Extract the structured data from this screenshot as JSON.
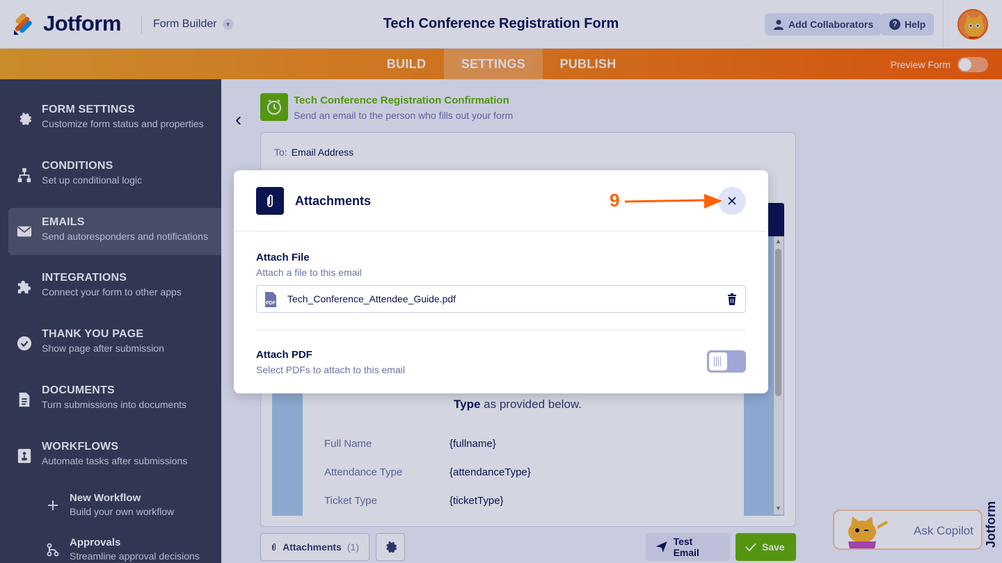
{
  "header": {
    "brand": "Jotform",
    "builder_menu": "Form Builder",
    "form_title": "Tech Conference Registration Form",
    "add_collaborators": "Add Collaborators",
    "help": "Help"
  },
  "nav": {
    "tabs": [
      {
        "label": "BUILD"
      },
      {
        "label": "SETTINGS"
      },
      {
        "label": "PUBLISH"
      }
    ],
    "active_tab": "SETTINGS",
    "preview_form": "Preview Form"
  },
  "sidebar": {
    "items": [
      {
        "title": "FORM SETTINGS",
        "subtitle": "Customize form status and properties",
        "icon": "gear-icon"
      },
      {
        "title": "CONDITIONS",
        "subtitle": "Set up conditional logic",
        "icon": "conditions-icon"
      },
      {
        "title": "EMAILS",
        "subtitle": "Send autoresponders and notifications",
        "icon": "envelope-icon"
      },
      {
        "title": "INTEGRATIONS",
        "subtitle": "Connect your form to other apps",
        "icon": "puzzle-icon"
      },
      {
        "title": "THANK YOU PAGE",
        "subtitle": "Show page after submission",
        "icon": "check-circle-icon"
      },
      {
        "title": "DOCUMENTS",
        "subtitle": "Turn submissions into documents",
        "icon": "document-icon"
      },
      {
        "title": "WORKFLOWS",
        "subtitle": "Automate tasks after submissions",
        "icon": "workflow-icon"
      }
    ],
    "active_item": "EMAILS",
    "sub_items": [
      {
        "title": "New Workflow",
        "subtitle": "Build your own workflow",
        "icon": "plus-icon"
      },
      {
        "title": "Approvals",
        "subtitle": "Streamline approval decisions",
        "icon": "approvals-icon"
      }
    ]
  },
  "email": {
    "title": "Tech Conference Registration Confirmation",
    "subtitle": "Send an email to the person who fills out your form",
    "to_label": "To:",
    "to_value": "Email Address",
    "body_text_bold": "Type",
    "body_text_rest": "as provided below.",
    "fields": [
      {
        "label": "Full Name",
        "value": "{fullname}"
      },
      {
        "label": "Attendance Type",
        "value": "{attendanceType}"
      },
      {
        "label": "Ticket Type",
        "value": "{ticketType}"
      }
    ]
  },
  "bottom_bar": {
    "attachments_label": "Attachments",
    "attachments_count": "(1)",
    "test_email": "Test Email",
    "save": "Save"
  },
  "copilot": {
    "label": "Ask Copilot"
  },
  "modal": {
    "title": "Attachments",
    "attach_file_title": "Attach File",
    "attach_file_sub": "Attach a file to this email",
    "file_name": "Tech_Conference_Attendee_Guide.pdf",
    "file_type_badge": "PDF",
    "attach_pdf_title": "Attach PDF",
    "attach_pdf_sub": "Select PDFs to attach to this email",
    "attach_pdf_enabled": false
  },
  "annotation": {
    "step_number": "9"
  },
  "colors": {
    "brand_orange": "#ff6100",
    "navy": "#0a1551",
    "green": "#64b200",
    "sidebar": "#3a3f53"
  }
}
